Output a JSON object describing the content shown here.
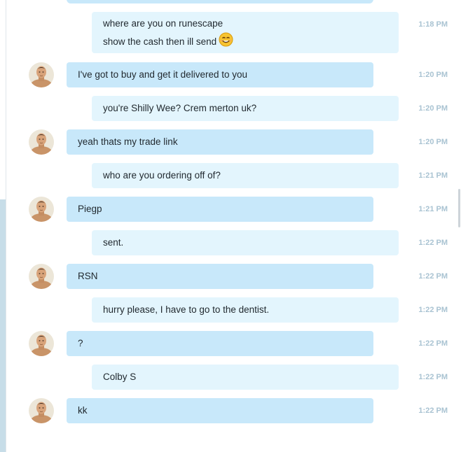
{
  "messages": [
    {
      "sender": "me",
      "lines": [
        "where are you on runescape",
        "show the cash then ill send"
      ],
      "emoji": "smile-emoji-icon",
      "time": "1:18 PM"
    },
    {
      "sender": "contact",
      "lines": [
        "I've got to buy and get it delivered to you"
      ],
      "time": "1:20 PM"
    },
    {
      "sender": "me",
      "lines": [
        "you're Shilly Wee? Crem merton uk?"
      ],
      "time": "1:20 PM"
    },
    {
      "sender": "contact",
      "lines": [
        "yeah thats my trade link"
      ],
      "time": "1:20 PM"
    },
    {
      "sender": "me",
      "lines": [
        "who are you ordering off of?"
      ],
      "time": "1:21 PM"
    },
    {
      "sender": "contact",
      "lines": [
        "Piegp"
      ],
      "time": "1:21 PM"
    },
    {
      "sender": "me",
      "lines": [
        "sent."
      ],
      "time": "1:22 PM"
    },
    {
      "sender": "contact",
      "lines": [
        "RSN"
      ],
      "time": "1:22 PM"
    },
    {
      "sender": "me",
      "lines": [
        "hurry please, I have to go to the dentist."
      ],
      "time": "1:22 PM"
    },
    {
      "sender": "contact",
      "lines": [
        "?"
      ],
      "time": "1:22 PM"
    },
    {
      "sender": "me",
      "lines": [
        "Colby S"
      ],
      "time": "1:22 PM"
    },
    {
      "sender": "contact",
      "lines": [
        "kk"
      ],
      "time": "1:22 PM"
    }
  ],
  "colors": {
    "received_bubble": "#c8e8fa",
    "sent_bubble": "#e3f5fd",
    "timestamp": "#a9c3d2",
    "text": "#222a30"
  }
}
